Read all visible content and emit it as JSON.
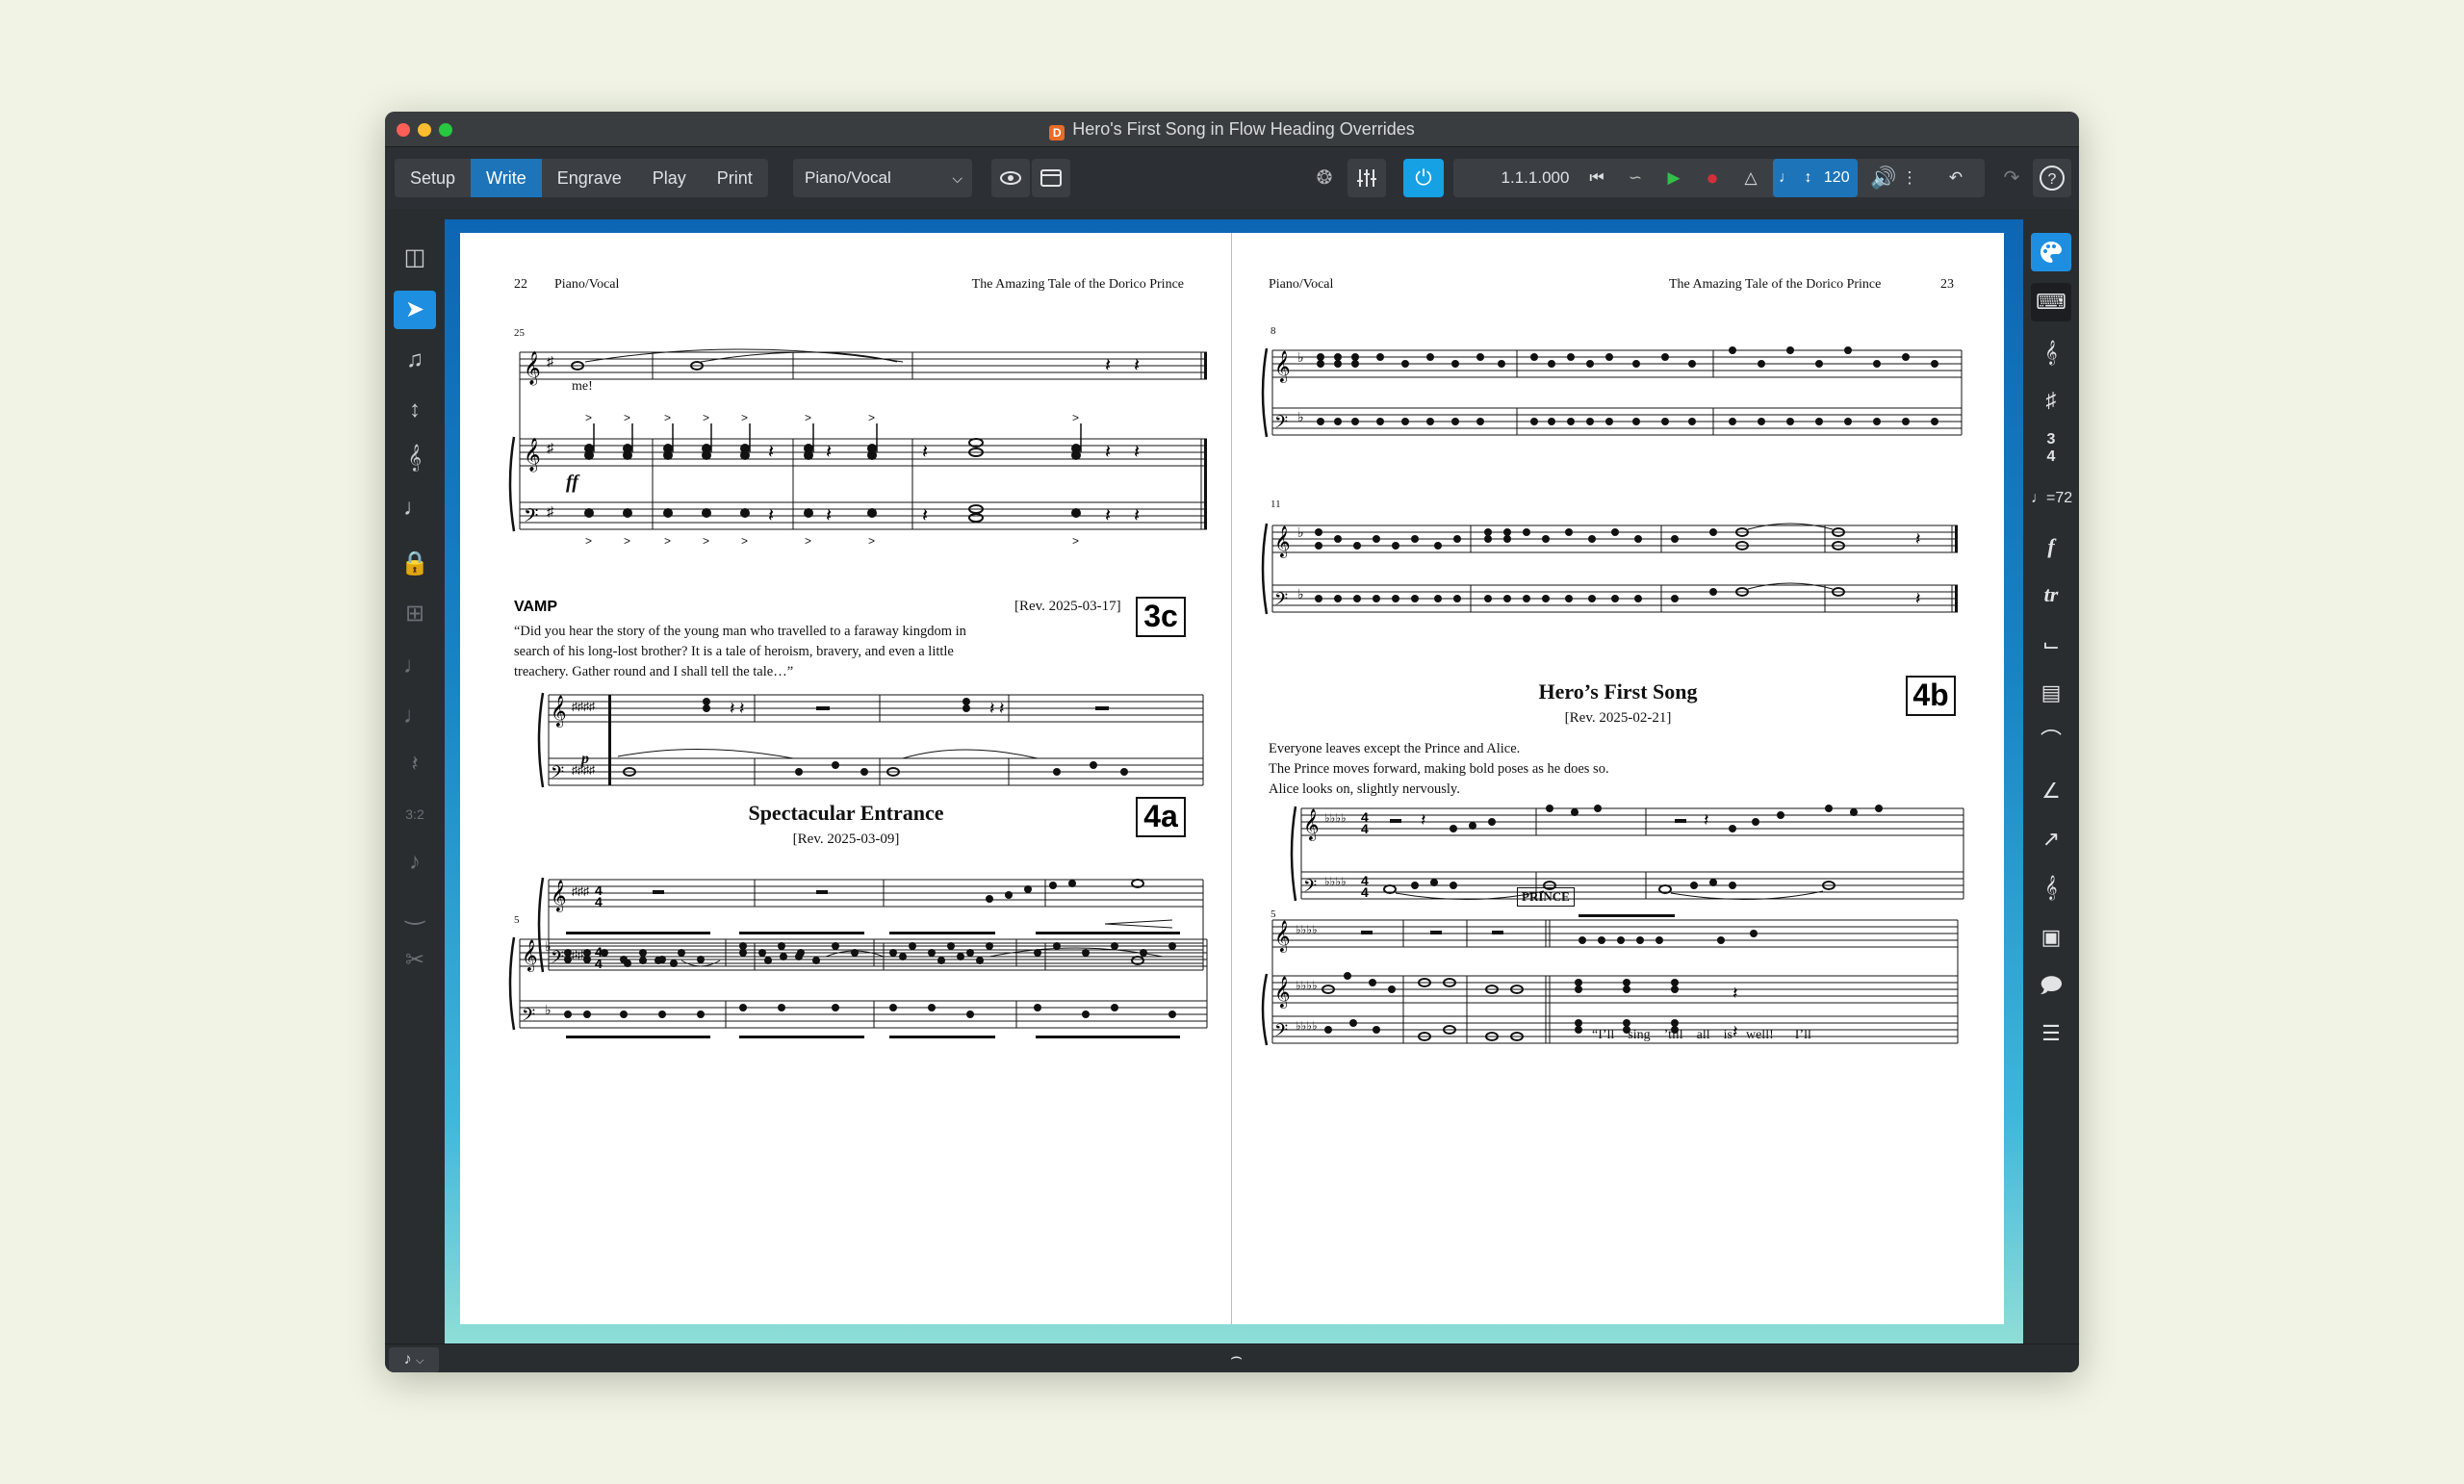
{
  "window": {
    "title": "Hero's First Song in Flow Heading Overrides",
    "app_icon": "D"
  },
  "toolbar": {
    "modes": [
      "Setup",
      "Write",
      "Engrave",
      "Play",
      "Print"
    ],
    "active_mode": "Write",
    "layout": "Piano/Vocal",
    "position": "1.1.1.000",
    "tempo": "120"
  },
  "left_page": {
    "page_number": "22",
    "layout_name": "Piano/Vocal",
    "project_title": "The Amazing Tale of the Dorico Prince",
    "bar_number_top": "25",
    "lyric": "me!",
    "dynamic_ff": "ff",
    "vamp": {
      "heading": "VAMP",
      "revision": "[Rev. 2025-03-17]",
      "number": "3c",
      "text": "“Did you hear the story of the young man who travelled to a faraway kingdom in search of his long-lost brother? It is a tale of heroism, bravery, and even a little treachery. Gather round and I shall tell the tale…”",
      "dynamic_p": "p"
    },
    "flow2": {
      "title": "Spectacular Entrance",
      "revision": "[Rev. 2025-03-09]",
      "number": "4a",
      "bar_number": "5"
    }
  },
  "right_page": {
    "page_number": "23",
    "layout_name": "Piano/Vocal",
    "project_title": "The Amazing Tale of the Dorico Prince",
    "bar_number_a": "8",
    "bar_number_b": "11",
    "flow": {
      "title": "Hero’s First Song",
      "revision": "[Rev. 2025-02-21]",
      "number": "4b",
      "text_lines": [
        "Everyone leaves except the Prince and Alice.",
        "The Prince moves forward, making bold poses as he does so.",
        "Alice looks on, slightly nervously."
      ],
      "bar_number": "5",
      "character": "PRINCE",
      "lyrics": [
        "“I’ll",
        "sing",
        "’till",
        "all",
        "is",
        "well!",
        "I’ll"
      ]
    }
  },
  "colors": {
    "accent": "#1e74b8",
    "highlight": "#1e8fe0",
    "power": "#15a1e4",
    "window": "#2a2d30"
  }
}
